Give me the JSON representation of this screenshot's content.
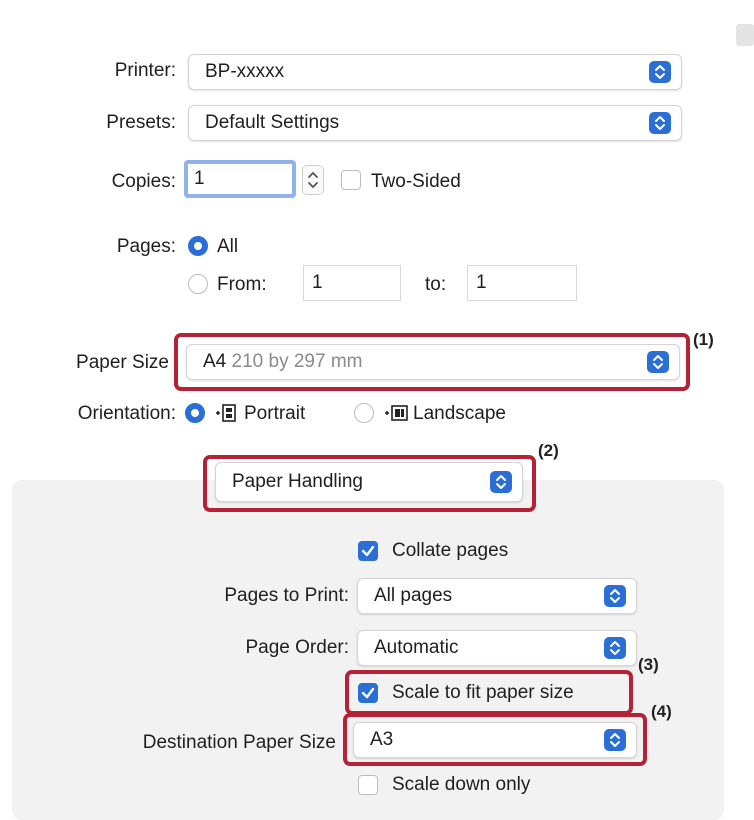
{
  "printer": {
    "label": "Printer:",
    "value": "BP-xxxxx"
  },
  "presets": {
    "label": "Presets:",
    "value": "Default Settings"
  },
  "copies": {
    "label": "Copies:",
    "value": "1",
    "two_sided_label": "Two-Sided",
    "two_sided_checked": false
  },
  "pages": {
    "label": "Pages:",
    "all_label": "All",
    "from_label": "From:",
    "from_value": "1",
    "to_label": "to:",
    "to_value": "1",
    "selected": "All"
  },
  "paper_size": {
    "label": "Paper Size",
    "value_main": "A4",
    "value_detail": "210 by 297 mm"
  },
  "orientation": {
    "label": "Orientation:",
    "portrait_label": "Portrait",
    "landscape_label": "Landscape",
    "selected": "Portrait"
  },
  "section_popup": {
    "value": "Paper Handling"
  },
  "paper_handling": {
    "collate_label": "Collate pages",
    "collate_checked": true,
    "pages_to_print_label": "Pages to Print:",
    "pages_to_print_value": "All pages",
    "page_order_label": "Page Order:",
    "page_order_value": "Automatic",
    "scale_fit_label": "Scale to fit paper size",
    "scale_fit_checked": true,
    "destination_label": "Destination Paper Size",
    "destination_value": "A3",
    "scale_down_label": "Scale down only",
    "scale_down_checked": false
  },
  "annotations": [
    "(1)",
    "(2)",
    "(3)",
    "(4)"
  ],
  "colors": {
    "accent": "#2b6fd6",
    "highlight": "#b52236",
    "panel": "#f2f2f2"
  }
}
